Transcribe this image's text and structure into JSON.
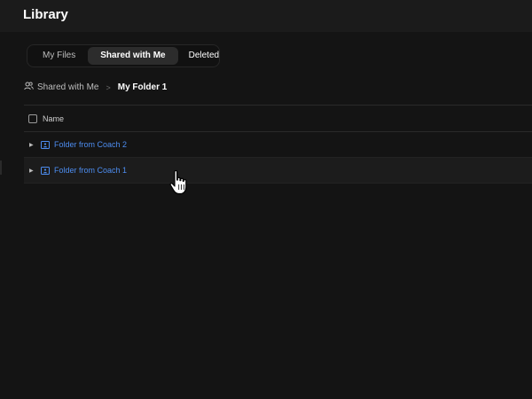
{
  "header": {
    "title": "Library"
  },
  "tabs": [
    {
      "label": "My Files",
      "active": false
    },
    {
      "label": "Shared with Me",
      "active": true
    },
    {
      "label": "Deleted",
      "active": false
    }
  ],
  "breadcrumb": {
    "parent": "Shared with Me",
    "separator": ">",
    "current": "My Folder 1",
    "parent_icon": "users-icon"
  },
  "table": {
    "columns": [
      "Name"
    ],
    "rows": [
      {
        "name": "Folder from Coach 2",
        "icon": "shared-folder-icon",
        "expand_icon": "caret-right-icon"
      },
      {
        "name": "Folder from Coach 1",
        "icon": "shared-folder-icon",
        "expand_icon": "caret-right-icon"
      }
    ]
  },
  "colors": {
    "background": "#141414",
    "topbar": "#1b1b1b",
    "link": "#4d8df0",
    "text": "#e6e6e6"
  }
}
